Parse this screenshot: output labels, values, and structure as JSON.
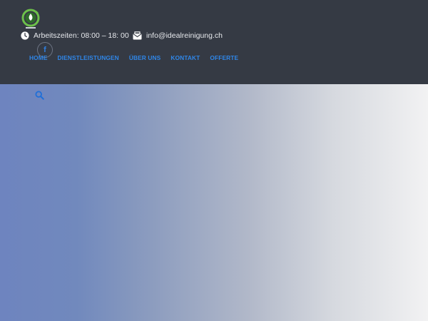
{
  "header": {
    "hours_text": "Arbeitszeiten: 08:00 – 18: 00",
    "email_text": "info@idealreinigung.ch",
    "social_facebook": "f",
    "icons": {
      "logo": "leaf-drop-logo",
      "clock": "clock-icon",
      "mail": "mail-icon",
      "facebook": "facebook-icon",
      "search": "search-icon"
    }
  },
  "nav": {
    "items": [
      {
        "label": "HOME"
      },
      {
        "label": "DIENSTLEISTUNGEN"
      },
      {
        "label": "ÜBER UNS"
      },
      {
        "label": "KONTAKT"
      },
      {
        "label": "OFFERTE"
      }
    ]
  },
  "colors": {
    "header_bg": "#353a44",
    "nav_link": "#2f86e8",
    "hero_gradient_start": "#6e84bf",
    "hero_gradient_end": "#f2f2f3"
  }
}
